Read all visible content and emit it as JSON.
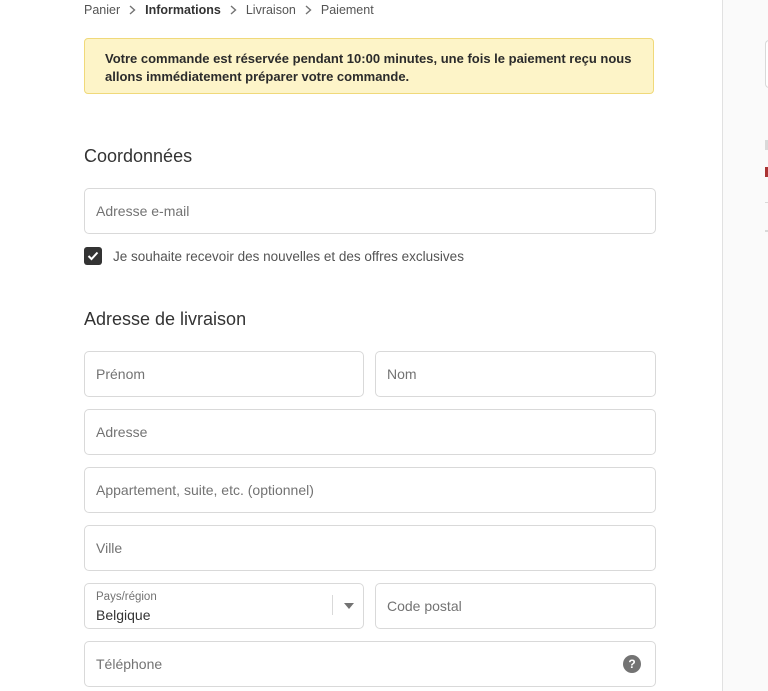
{
  "breadcrumb": {
    "items": [
      "Panier",
      "Informations",
      "Livraison",
      "Paiement"
    ],
    "current_index": 1
  },
  "notice": {
    "text": "Votre commande est réservée pendant 10:00 minutes, une fois le paiement reçu nous allons immédiatement préparer votre commande."
  },
  "contact": {
    "title": "Coordonnées",
    "email_placeholder": "Adresse e-mail",
    "newsletter_label": "Je souhaite recevoir des nouvelles et des offres exclusives",
    "newsletter_checked": true
  },
  "shipping": {
    "title": "Adresse de livraison",
    "first_name_placeholder": "Prénom",
    "last_name_placeholder": "Nom",
    "address_placeholder": "Adresse",
    "apartment_placeholder": "Appartement, suite, etc. (optionnel)",
    "city_placeholder": "Ville",
    "country_label": "Pays/région",
    "country_value": "Belgique",
    "postal_placeholder": "Code postal",
    "phone_placeholder": "Téléphone",
    "phone_help_glyph": "?"
  },
  "colors": {
    "notice_bg": "#fdf4c8",
    "notice_border": "#f0d97a",
    "checkbox": "#333333",
    "border": "#d9d9d9"
  }
}
